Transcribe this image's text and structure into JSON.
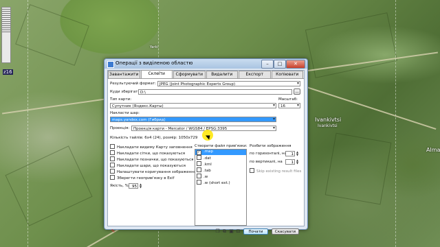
{
  "map": {
    "labels": [
      "Ivankivtsi",
      "Ivankivtsi",
      "Almaze",
      "Yarki"
    ],
    "zoom_label": "z16"
  },
  "dialog": {
    "title": "Операції з виділеною областю",
    "tabs": [
      "Завантажити",
      "Склеїти",
      "Сформувати",
      "Видалити",
      "Експорт",
      "Копіювати"
    ],
    "active_tab": "Склеїти",
    "result_format_label": "Результуючий формат:",
    "result_format_value": "JPEG (Joint Photographic Experts Group)",
    "save_to_label": "Куди зберігати:",
    "save_to_value": "D:\\",
    "browse_label": "...",
    "map_type_label": "Тип карти:",
    "map_type_value": "Супутник (Яндекс.Карты)",
    "scale_label": "Масштаб:",
    "scale_value": "16",
    "overlay_label": "Накласти шар:",
    "overlay_value": "maps.yandex.com (Гибрид)",
    "projection_label": "Проекція:",
    "projection_value": "Проекція карти - Mercator / WGS84 / EPSG:3395",
    "tile_info": "Кількість тайлів: 6x4 (24), розмір: 1050x729",
    "options": [
      {
        "label": "Накладати видиму Карту заповнення",
        "checked": false
      },
      {
        "label": "Накладати сітки, що показуються",
        "checked": false
      },
      {
        "label": "Накладати позначки, що показуються",
        "checked": false
      },
      {
        "label": "Накладати шари, що показуються",
        "checked": false
      },
      {
        "label": "Налаштувати коригування зображення",
        "checked": false
      },
      {
        "label": "Зберегти геоприв'язку в Exif",
        "checked": false
      }
    ],
    "quality_label": "Якість, %",
    "quality_value": "95",
    "georef_label": "Створити файл прив'язки:",
    "georef_items": [
      {
        "label": ".map",
        "checked": true
      },
      {
        "label": ".dat",
        "checked": false
      },
      {
        "label": ".kml",
        "checked": false
      },
      {
        "label": ".tab",
        "checked": false
      },
      {
        "label": ".w",
        "checked": false
      },
      {
        "label": ".w (short ext.)",
        "checked": false
      }
    ],
    "split_label": "Розбити зображення",
    "split_horizontal_label": "по горизонталі, на",
    "split_horizontal_value": "1",
    "split_vertical_label": "по вертикалі, на",
    "split_vertical_value": "1",
    "skip_existing_label": "Skip existing result files",
    "start_button": "Почати",
    "cancel_button": "Скасувати",
    "window_buttons": {
      "minimize": "–",
      "maximize": "□",
      "close": "✕"
    }
  }
}
